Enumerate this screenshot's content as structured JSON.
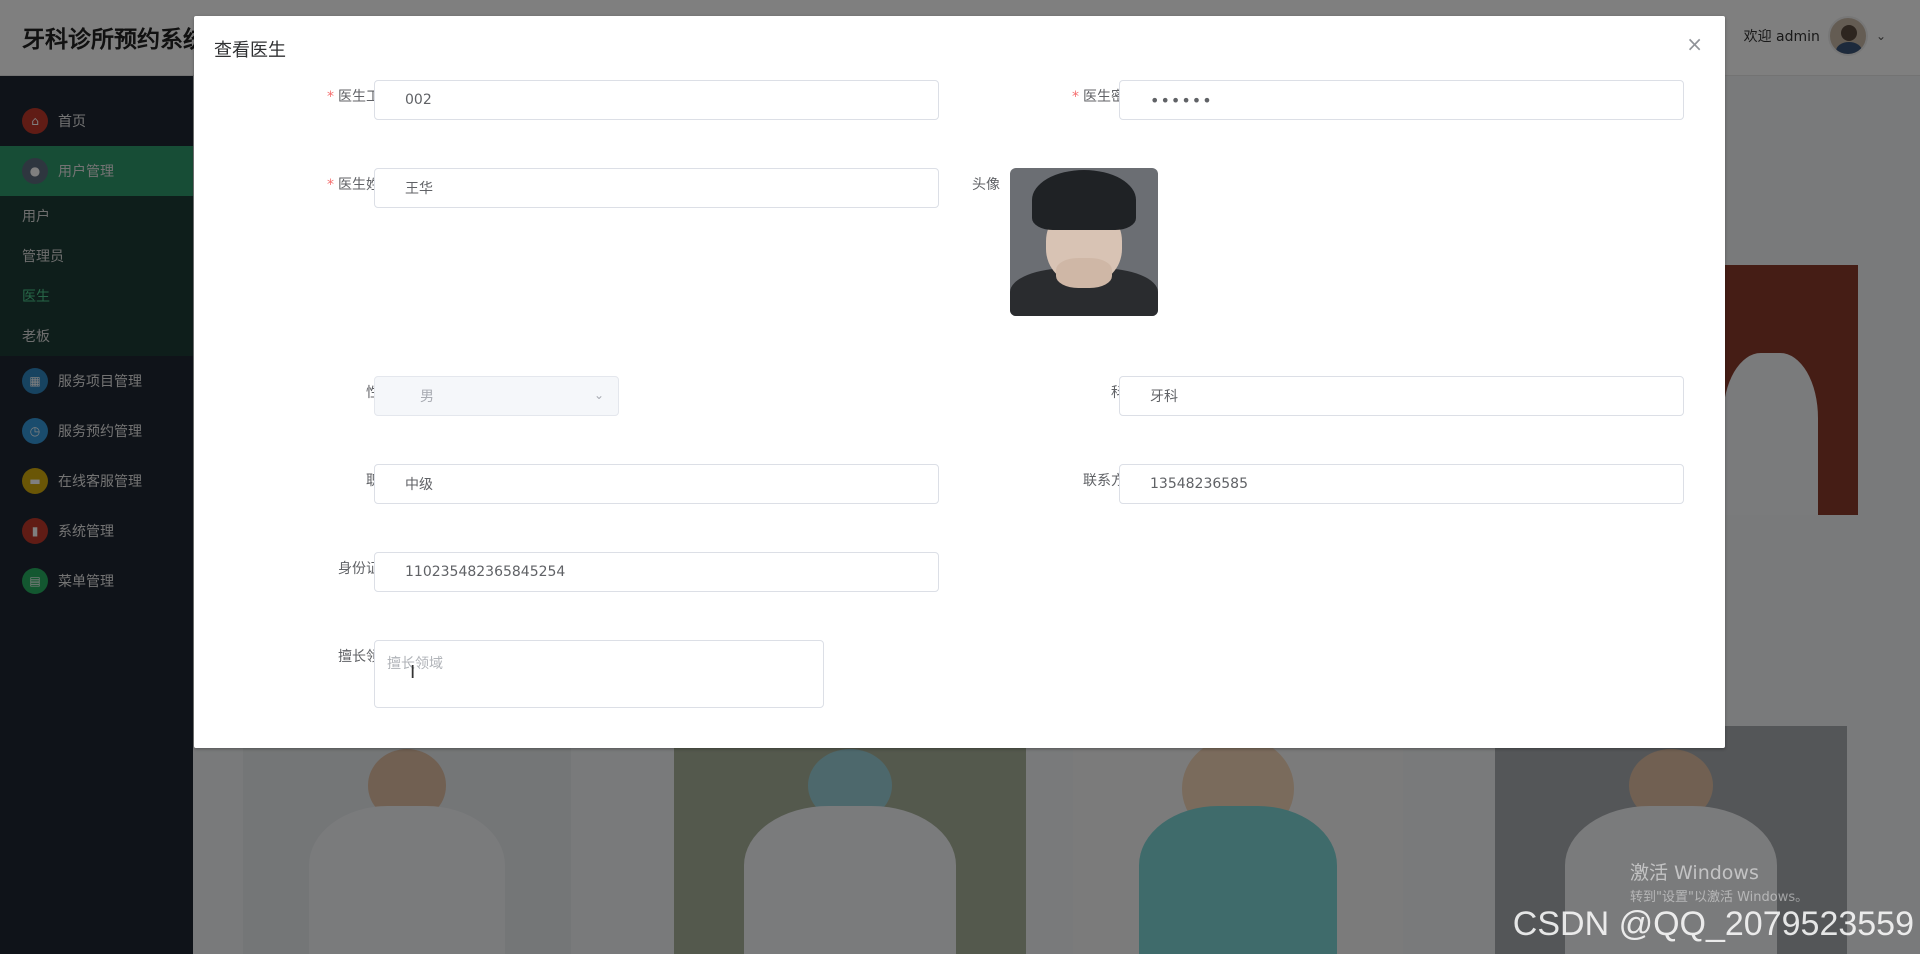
{
  "app": {
    "title": "牙科诊所预约系统"
  },
  "header": {
    "welcome": "欢迎 admin"
  },
  "sidebar": {
    "items": [
      {
        "label": "首页",
        "icon": "home-icon",
        "color": "#c0392b"
      },
      {
        "label": "用户管理",
        "icon": "user-icon",
        "color": "#5d6d7e"
      },
      {
        "label": "服务项目管理",
        "icon": "service-icon",
        "color": "#2e86c1"
      },
      {
        "label": "服务预约管理",
        "icon": "appointment-icon",
        "color": "#3498db"
      },
      {
        "label": "在线客服管理",
        "icon": "chat-icon",
        "color": "#d4ac0d"
      },
      {
        "label": "系统管理",
        "icon": "system-icon",
        "color": "#c0392b"
      },
      {
        "label": "菜单管理",
        "icon": "menu-icon",
        "color": "#27ae60"
      }
    ],
    "sub_items": [
      {
        "label": "用户"
      },
      {
        "label": "管理员"
      },
      {
        "label": "医生"
      },
      {
        "label": "老板"
      }
    ]
  },
  "dialog": {
    "title": "查看医生",
    "close": "×",
    "fields": {
      "doctor_id": {
        "label": "医生工号",
        "value": "002"
      },
      "doctor_password": {
        "label": "医生密码",
        "value": "••••••"
      },
      "doctor_name": {
        "label": "医生姓名",
        "value": "王华"
      },
      "avatar": {
        "label": "头像"
      },
      "gender": {
        "label": "性别",
        "value": "男"
      },
      "department": {
        "label": "科室",
        "value": "牙科"
      },
      "title": {
        "label": "职称",
        "value": "中级"
      },
      "contact": {
        "label": "联系方式",
        "value": "13548236585"
      },
      "id_card": {
        "label": "身份证号",
        "value": "110235482365845254"
      },
      "specialty": {
        "label": "擅长领域",
        "placeholder": "擅长领域"
      }
    }
  },
  "overlay_text": {
    "activate_windows": "激活 Windows",
    "activate_hint": "转到\"设置\"以激活 Windows。",
    "watermark": "CSDN @QQ_2079523559"
  }
}
